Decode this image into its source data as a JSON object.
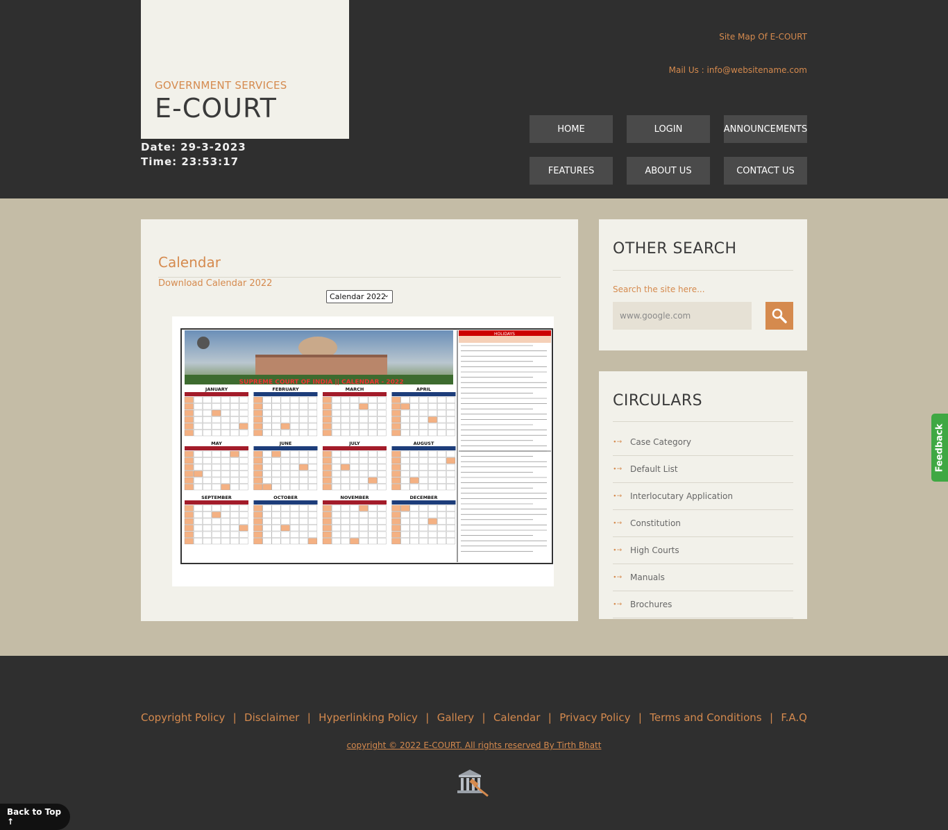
{
  "header": {
    "logo_subtitle": "GOVERNMENT SERVICES",
    "logo_title": "E-COURT",
    "date_line": "Date: 29-3-2023",
    "time_line": "Time: 23:53:17",
    "sitemap": "Site Map Of E-COURT",
    "mail": "Mail Us : info@websitename.com",
    "nav": [
      "HOME",
      "LOGIN",
      "ANNOUNCEMENTS",
      "FEATURES",
      "ABOUT US",
      "CONTACT US"
    ]
  },
  "main": {
    "heading": "Calendar",
    "download_link": "Download Calendar 2022",
    "select_value": "Calendar 2022",
    "image_banner": "SUPREME COURT OF INDIA || CALENDAR - 2022",
    "months": [
      "JANUARY",
      "FEBRUARY",
      "MARCH",
      "APRIL",
      "MAY",
      "JUNE",
      "JULY",
      "AUGUST",
      "SEPTEMBER",
      "OCTOBER",
      "NOVEMBER",
      "DECEMBER"
    ],
    "holidays_title": "HOLIDAYS"
  },
  "sidebar": {
    "search": {
      "title": "OTHER SEARCH",
      "label": "Search the site here...",
      "placeholder": "www.google.com"
    },
    "circulars": {
      "title": "CIRCULARS",
      "items": [
        "Case Category",
        "Default List",
        "Interlocutary Application",
        "Constitution",
        "High Courts",
        "Manuals",
        "Brochures"
      ]
    }
  },
  "feedback": "Feedback",
  "footer": {
    "links": [
      "Copyright Policy",
      "Disclaimer",
      "Hyperlinking Policy",
      "Gallery",
      "Calendar",
      "Privacy Policy",
      "Terms and Conditions",
      "F.A.Q"
    ],
    "separator": "|",
    "copyright": "copyright © 2022 E-COURT. All rights reserved By Tirth Bhatt"
  },
  "back_to_top": "Back to Top ↑",
  "colors": {
    "accent": "#d58a4e",
    "dark": "#2f2f2f",
    "panel": "#f2f1ea",
    "beige": "#c4bca6"
  }
}
